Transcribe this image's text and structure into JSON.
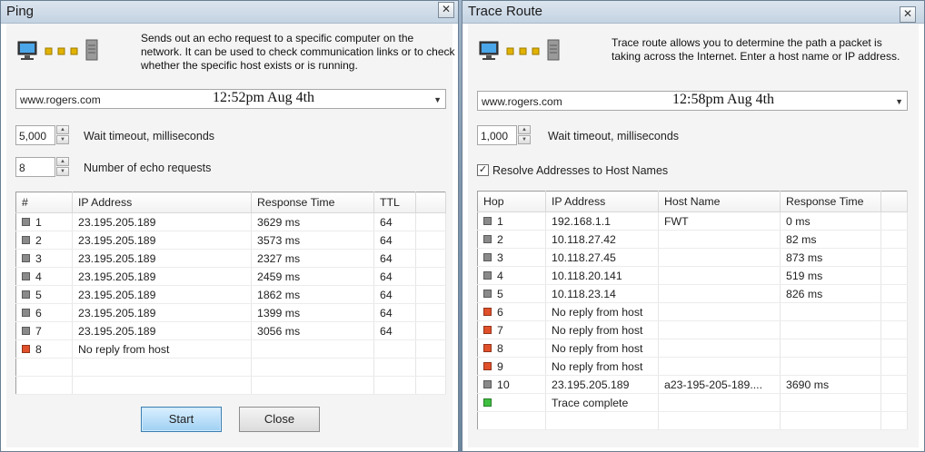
{
  "colors": {
    "status_ok": "#8a8a8a",
    "status_fail": "#e0502a",
    "status_complete": "#3fbf3f",
    "device_dot": "#e2b200"
  },
  "ping": {
    "title": "Ping",
    "close_glyph": "✕",
    "description": "Sends out an echo request to a specific computer on the network. It can be used to check communication links or to check whether the specific host exists or is running.",
    "host": "www.rogers.com",
    "timestamp": "12:52pm Aug 4th",
    "timeout_value": "5,000",
    "timeout_label": "Wait timeout, milliseconds",
    "count_value": "8",
    "count_label": "Number of echo requests",
    "columns": [
      "#",
      "IP Address",
      "Response Time",
      "TTL"
    ],
    "rows": [
      {
        "num": "1",
        "status": "ok",
        "ip": "23.195.205.189",
        "time": "3629 ms",
        "ttl": "64"
      },
      {
        "num": "2",
        "status": "ok",
        "ip": "23.195.205.189",
        "time": "3573 ms",
        "ttl": "64"
      },
      {
        "num": "3",
        "status": "ok",
        "ip": "23.195.205.189",
        "time": "2327 ms",
        "ttl": "64"
      },
      {
        "num": "4",
        "status": "ok",
        "ip": "23.195.205.189",
        "time": "2459 ms",
        "ttl": "64"
      },
      {
        "num": "5",
        "status": "ok",
        "ip": "23.195.205.189",
        "time": "1862 ms",
        "ttl": "64"
      },
      {
        "num": "6",
        "status": "ok",
        "ip": "23.195.205.189",
        "time": "1399 ms",
        "ttl": "64"
      },
      {
        "num": "7",
        "status": "ok",
        "ip": "23.195.205.189",
        "time": "3056 ms",
        "ttl": "64"
      },
      {
        "num": "8",
        "status": "fail",
        "ip": "No reply from host",
        "time": "",
        "ttl": ""
      }
    ],
    "start_label": "Start",
    "close_label": "Close"
  },
  "trace": {
    "title": "Trace Route",
    "close_glyph": "✕",
    "description": "Trace route allows you to determine the path a packet is taking across the Internet. Enter a host name or IP address.",
    "host": "www.rogers.com",
    "timestamp": "12:58pm Aug 4th",
    "timeout_value": "1,000",
    "timeout_label": "Wait timeout, milliseconds",
    "resolve_label": "Resolve Addresses to Host Names",
    "resolve_check": "✓",
    "columns": [
      "Hop",
      "IP Address",
      "Host Name",
      "Response Time"
    ],
    "rows": [
      {
        "num": "1",
        "status": "ok",
        "ip": "192.168.1.1",
        "host": "FWT",
        "time": "0 ms"
      },
      {
        "num": "2",
        "status": "ok",
        "ip": "10.118.27.42",
        "host": "",
        "time": "82 ms"
      },
      {
        "num": "3",
        "status": "ok",
        "ip": "10.118.27.45",
        "host": "",
        "time": "873 ms"
      },
      {
        "num": "4",
        "status": "ok",
        "ip": "10.118.20.141",
        "host": "",
        "time": "519 ms"
      },
      {
        "num": "5",
        "status": "ok",
        "ip": "10.118.23.14",
        "host": "",
        "time": "826 ms"
      },
      {
        "num": "6",
        "status": "fail",
        "ip": "No reply from host",
        "host": "",
        "time": ""
      },
      {
        "num": "7",
        "status": "fail",
        "ip": "No reply from host",
        "host": "",
        "time": ""
      },
      {
        "num": "8",
        "status": "fail",
        "ip": "No reply from host",
        "host": "",
        "time": ""
      },
      {
        "num": "9",
        "status": "fail",
        "ip": "No reply from host",
        "host": "",
        "time": ""
      },
      {
        "num": "10",
        "status": "ok",
        "ip": "23.195.205.189",
        "host": "a23-195-205-189....",
        "time": "3690 ms"
      },
      {
        "num": "",
        "status": "complete",
        "ip": "Trace complete",
        "host": "",
        "time": ""
      }
    ]
  }
}
